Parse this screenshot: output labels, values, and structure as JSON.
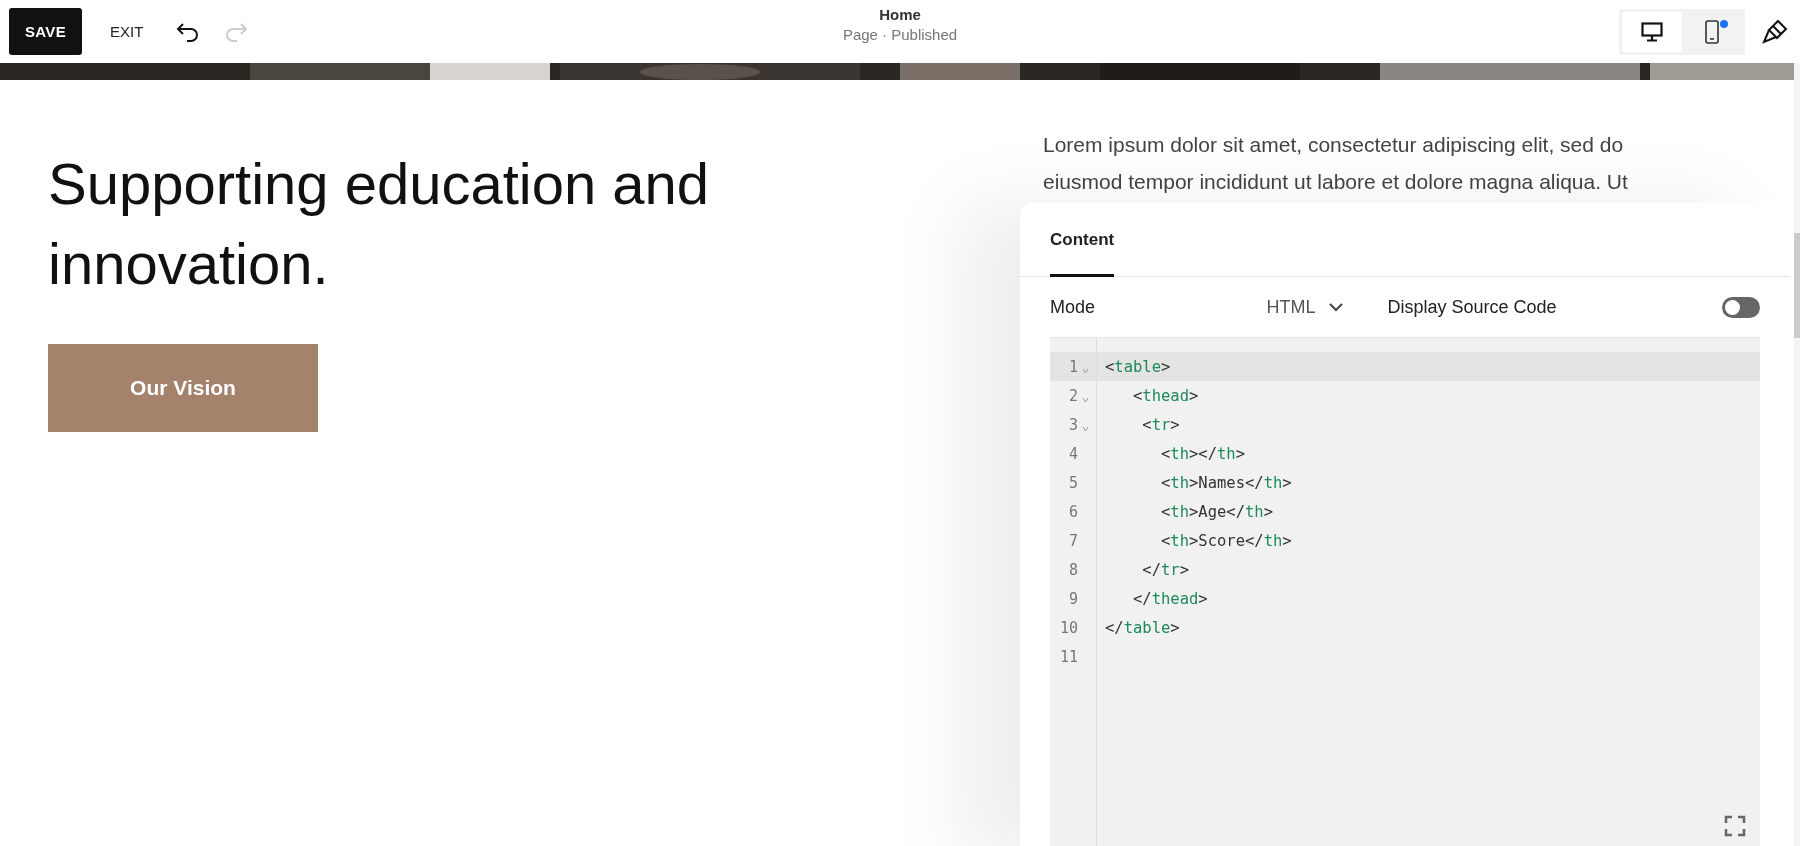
{
  "toolbar": {
    "save": "SAVE",
    "exit": "EXIT",
    "undo": {
      "disabled": false
    },
    "redo": {
      "disabled": true
    },
    "title": "Home",
    "subtitle": "Page · Published",
    "devices": [
      {
        "kind": "desktop",
        "selected": true,
        "dot": false
      },
      {
        "kind": "mobile",
        "selected": false,
        "dot": true
      }
    ]
  },
  "section": {
    "heading": "Supporting education and innovation.",
    "button": "Our Vision",
    "paragraph": "Lorem ipsum dolor sit amet, consectetur adipiscing elit, sed do eiusmod tempor incididunt ut labore et dolore magna aliqua. Ut"
  },
  "panel": {
    "tabs": [
      {
        "label": "Content",
        "selected": true
      }
    ],
    "mode_label": "Mode",
    "mode_value": "HTML",
    "source_label": "Display Source Code",
    "source_toggle": {
      "on": false
    },
    "code_lines": [
      {
        "number": "1",
        "foldable": true,
        "active": true,
        "text": "<table>"
      },
      {
        "number": "2",
        "foldable": true,
        "active": false,
        "text": "   <thead>"
      },
      {
        "number": "3",
        "foldable": true,
        "active": false,
        "text": "    <tr>"
      },
      {
        "number": "4",
        "foldable": false,
        "active": false,
        "text": "      <th></th>"
      },
      {
        "number": "5",
        "foldable": false,
        "active": false,
        "text": "      <th>Names</th>"
      },
      {
        "number": "6",
        "foldable": false,
        "active": false,
        "text": "      <th>Age</th>"
      },
      {
        "number": "7",
        "foldable": false,
        "active": false,
        "text": "      <th>Score</th>"
      },
      {
        "number": "8",
        "foldable": false,
        "active": false,
        "text": "    </tr>"
      },
      {
        "number": "9",
        "foldable": false,
        "active": false,
        "text": "   </thead>"
      },
      {
        "number": "10",
        "foldable": false,
        "active": false,
        "text": "</table>"
      },
      {
        "number": "11",
        "foldable": false,
        "active": false
      }
    ]
  }
}
